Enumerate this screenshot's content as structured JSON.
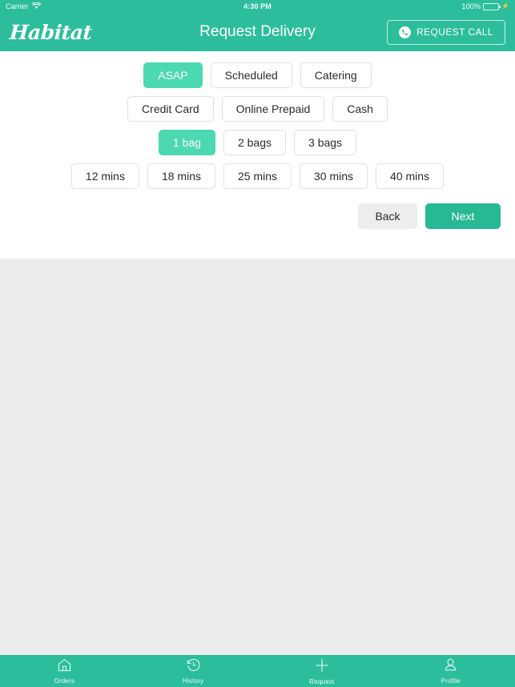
{
  "status_bar": {
    "carrier": "Carrier",
    "wifi_icon": "wifi-icon",
    "time": "4:30 PM",
    "battery_percent": "100%",
    "battery_icon": "battery-full-icon",
    "charging_icon": "charging-bolt-icon"
  },
  "header": {
    "brand": "Habitat",
    "title": "Request Delivery",
    "request_call_label": "REQUEST CALL",
    "request_call_icon": "phone-icon",
    "background_color": "#2CBE9C"
  },
  "form": {
    "rows": [
      {
        "name": "delivery-type",
        "options": [
          {
            "label": "ASAP",
            "selected": true
          },
          {
            "label": "Scheduled",
            "selected": false
          },
          {
            "label": "Catering",
            "selected": false
          }
        ]
      },
      {
        "name": "payment-method",
        "options": [
          {
            "label": "Credit Card",
            "selected": false
          },
          {
            "label": "Online Prepaid",
            "selected": false
          },
          {
            "label": "Cash",
            "selected": false
          }
        ]
      },
      {
        "name": "bag-count",
        "options": [
          {
            "label": "1 bag",
            "selected": true
          },
          {
            "label": "2 bags",
            "selected": false
          },
          {
            "label": "3 bags",
            "selected": false
          }
        ]
      },
      {
        "name": "prep-time",
        "options": [
          {
            "label": "12 mins",
            "selected": false
          },
          {
            "label": "18 mins",
            "selected": false
          },
          {
            "label": "25 mins",
            "selected": false
          },
          {
            "label": "30 mins",
            "selected": false
          },
          {
            "label": "40 mins",
            "selected": false
          }
        ]
      }
    ],
    "back_label": "Back",
    "next_label": "Next",
    "selected_color": "#4CD8B0",
    "next_color": "#27B894",
    "back_color": "#EDEDED"
  },
  "tab_bar": {
    "background_color": "#2CBE9C",
    "tabs": [
      {
        "label": "Orders",
        "icon": "home-icon"
      },
      {
        "label": "History",
        "icon": "clock-rewind-icon"
      },
      {
        "label": "Request",
        "icon": "plus-icon"
      },
      {
        "label": "Profile",
        "icon": "person-icon"
      }
    ]
  }
}
